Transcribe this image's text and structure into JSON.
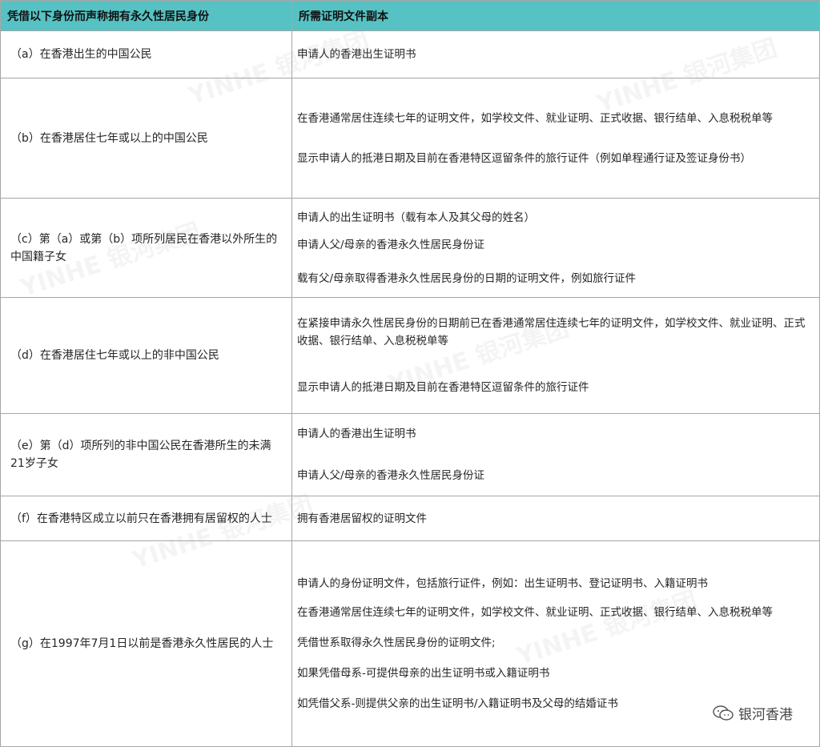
{
  "header": {
    "col1": "凭借以下身份而声称拥有永久性居民身份",
    "col2": "所需证明文件副本"
  },
  "rows": [
    {
      "label": "（a）在香港出生的中国公民",
      "docs": [
        "申请人的香港出生证明书"
      ]
    },
    {
      "label": "（b）在香港居住七年或以上的中国公民",
      "docs": [
        "在香港通常居住连续七年的证明文件，如学校文件、就业证明、正式收据、银行结单、入息税税单等",
        "显示申请人的抵港日期及目前在香港特区逗留条件的旅行证件（例如单程通行证及签证身份书）"
      ]
    },
    {
      "label": "（c）第（a）或第（b）项所列居民在香港以外所生的中国籍子女",
      "docs": [
        "申请人的出生证明书（载有本人及其父母的姓名）",
        "申请人父/母亲的香港永久性居民身份证",
        "载有父/母亲取得香港永久性居民身份的日期的证明文件，例如旅行证件"
      ]
    },
    {
      "label": "（d）在香港居住七年或以上的非中国公民",
      "docs": [
        "在紧接申请永久性居民身份的日期前已在香港通常居住连续七年的证明文件，如学校文件、就业证明、正式收据、银行结单、入息税税单等",
        "显示申请人的抵港日期及目前在香港特区逗留条件的旅行证件"
      ]
    },
    {
      "label": "（e）第（d）项所列的非中国公民在香港所生的未满21岁子女",
      "docs": [
        "申请人的香港出生证明书",
        "申请人父/母亲的香港永久性居民身份证"
      ]
    },
    {
      "label": "（f）在香港特区成立以前只在香港拥有居留权的人士",
      "docs": [
        "拥有香港居留权的证明文件"
      ]
    },
    {
      "label": "（g）在1997年7月1日以前是香港永久性居民的人士",
      "docs": [
        "申请人的身份证明文件，包括旅行证件，例如：出生证明书、登记证明书、入籍证明书",
        "在香港通常居住连续七年的证明文件，如学校文件、就业证明、正式收据、银行结单、入息税税单等",
        "凭借世系取得永久性居民身份的证明文件;",
        "如果凭借母系-可提供母亲的出生证明书或入籍证明书",
        "如凭借父系-则提供父亲的出生证明书/入籍证明书及父母的结婚证书"
      ]
    }
  ],
  "watermark": {
    "latin": "YINHE",
    "cn": "银河集团"
  },
  "brand": {
    "label": "银河香港",
    "icon": "wechat-icon"
  }
}
